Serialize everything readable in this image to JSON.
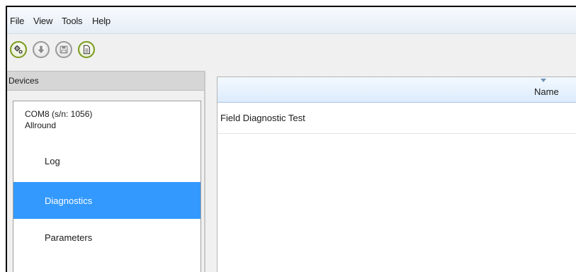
{
  "menu": {
    "items": [
      "File",
      "View",
      "Tools",
      "Help"
    ]
  },
  "toolbar": {
    "buttons": [
      {
        "icon": "gears-icon",
        "active": true
      },
      {
        "icon": "download-icon",
        "active": false
      },
      {
        "icon": "save-icon",
        "active": false
      },
      {
        "icon": "document-icon",
        "active": true
      }
    ]
  },
  "sidebar": {
    "header": "Devices",
    "device": {
      "port_line": "COM8 (s/n: 1056)",
      "model_line": "Allround"
    },
    "items": [
      {
        "label": "Log",
        "selected": false
      },
      {
        "label": "Diagnostics",
        "selected": true
      },
      {
        "label": "Parameters",
        "selected": false
      }
    ]
  },
  "main": {
    "column_header": "Name",
    "rows": [
      "Field Diagnostic Test"
    ]
  },
  "colors": {
    "selection": "#3399ff",
    "active_button_border": "#7a9a1e"
  }
}
